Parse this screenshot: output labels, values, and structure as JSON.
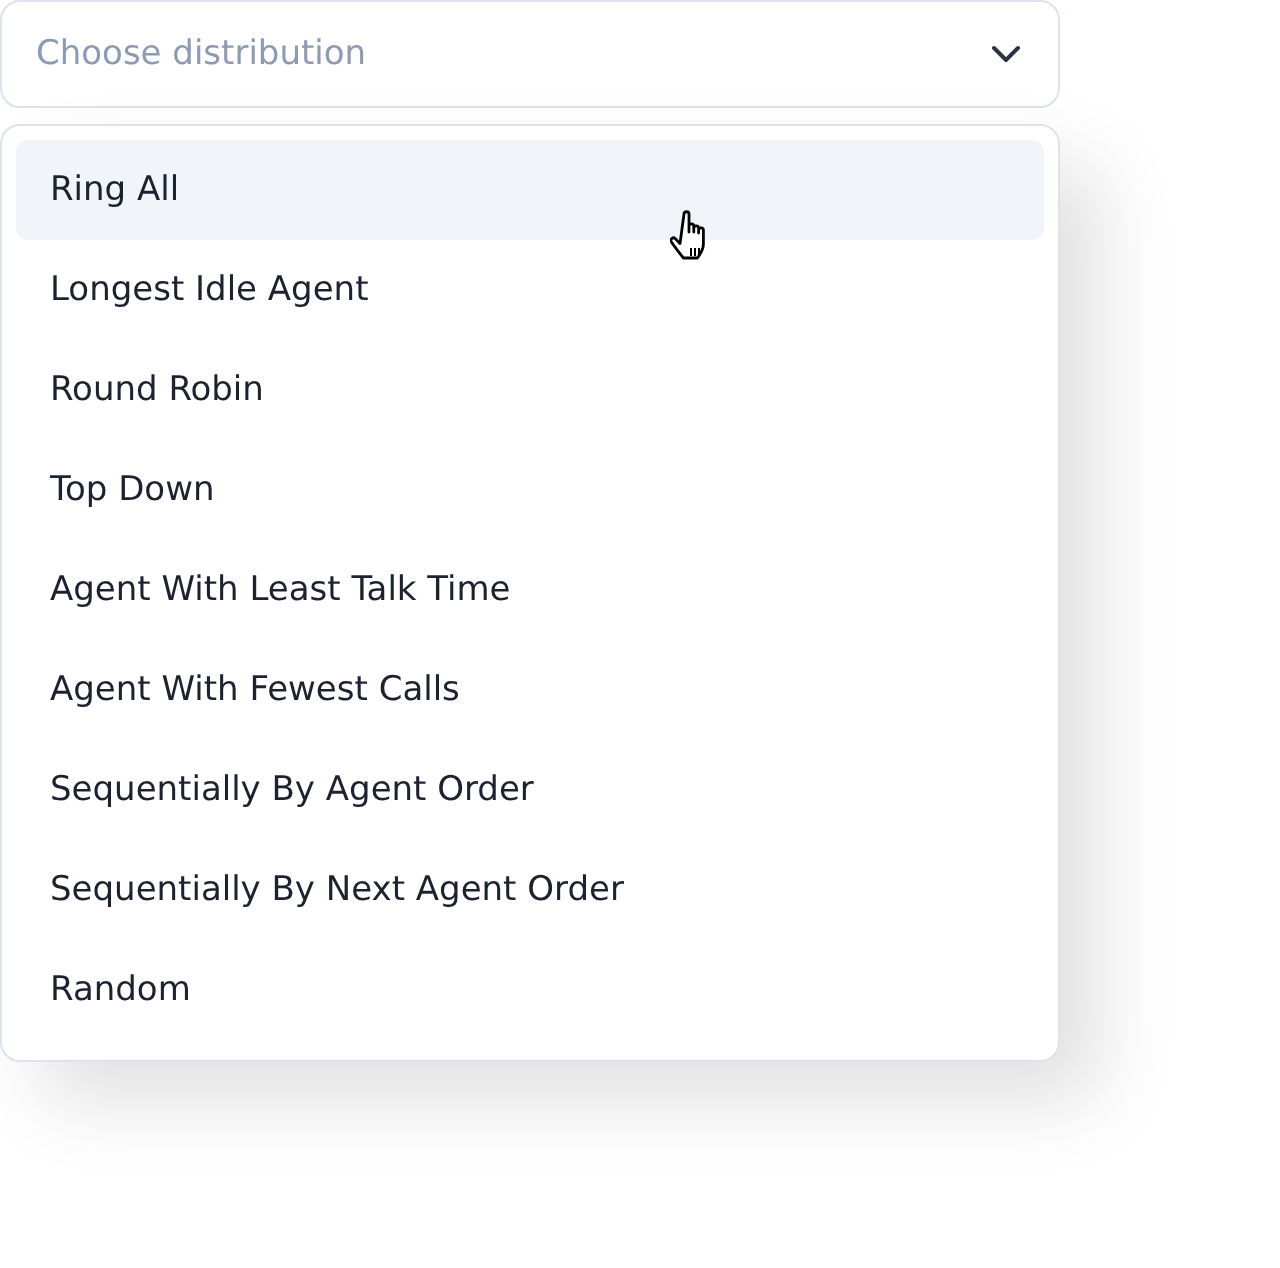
{
  "select": {
    "placeholder": "Choose distribution",
    "expanded": true
  },
  "options": [
    {
      "label": "Ring All",
      "highlighted": true
    },
    {
      "label": "Longest Idle Agent",
      "highlighted": false
    },
    {
      "label": "Round Robin",
      "highlighted": false
    },
    {
      "label": "Top Down",
      "highlighted": false
    },
    {
      "label": "Agent With Least Talk Time",
      "highlighted": false
    },
    {
      "label": "Agent With Fewest Calls",
      "highlighted": false
    },
    {
      "label": "Sequentially By Agent Order",
      "highlighted": false
    },
    {
      "label": "Sequentially By Next Agent Order",
      "highlighted": false
    },
    {
      "label": "Random",
      "highlighted": false
    }
  ]
}
